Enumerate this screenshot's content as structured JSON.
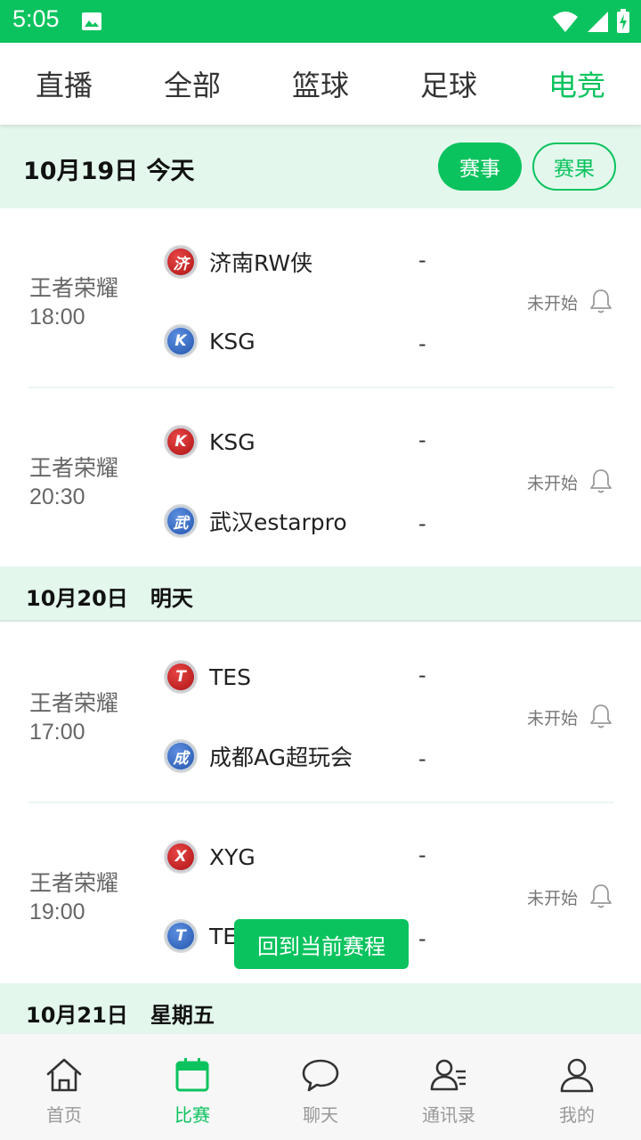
{
  "status_bar": {
    "time": "5:05"
  },
  "top_tabs": [
    {
      "label": "直播",
      "active": false
    },
    {
      "label": "全部",
      "active": false
    },
    {
      "label": "篮球",
      "active": false
    },
    {
      "label": "足球",
      "active": false
    },
    {
      "label": "电竞",
      "active": true
    }
  ],
  "section1": {
    "date": "10月19日 今天",
    "btn_events": "赛事",
    "btn_results": "赛果"
  },
  "matches": [
    {
      "league": "王者荣耀",
      "time": "18:00",
      "team1": {
        "logo": "济",
        "name": "济南RW侠",
        "score": "-"
      },
      "team2": {
        "logo": "K",
        "name": "KSG",
        "score": "-"
      },
      "status": "未开始"
    },
    {
      "league": "王者荣耀",
      "time": "20:30",
      "team1": {
        "logo": "K",
        "name": "KSG",
        "score": "-"
      },
      "team2": {
        "logo": "武",
        "name": "武汉estarpro",
        "score": "-"
      },
      "status": "未开始"
    },
    {
      "league": "王者荣耀",
      "time": "17:00",
      "team1": {
        "logo": "T",
        "name": "TES",
        "score": "-"
      },
      "team2": {
        "logo": "成",
        "name": "成都AG超玩会",
        "score": "-"
      },
      "status": "未开始"
    },
    {
      "league": "王者荣耀",
      "time": "19:00",
      "team1": {
        "logo": "X",
        "name": "XYG",
        "score": "-"
      },
      "team2": {
        "logo": "T",
        "name": "TES",
        "score": "-"
      },
      "status": "未开始"
    }
  ],
  "section2": {
    "date": "10月20日",
    "weekday": "明天"
  },
  "section3": {
    "date": "10月21日",
    "weekday": "星期五"
  },
  "toast": "回到当前赛程",
  "bottom_nav": [
    {
      "label": "首页",
      "icon": "home-icon",
      "active": false
    },
    {
      "label": "比赛",
      "icon": "calendar-icon",
      "active": true
    },
    {
      "label": "聊天",
      "icon": "chat-icon",
      "active": false
    },
    {
      "label": "通讯录",
      "icon": "contacts-icon",
      "active": false
    },
    {
      "label": "我的",
      "icon": "profile-icon",
      "active": false
    }
  ],
  "colors": {
    "accent": "#0ac35e",
    "section_bg": "#e3f7ec"
  }
}
